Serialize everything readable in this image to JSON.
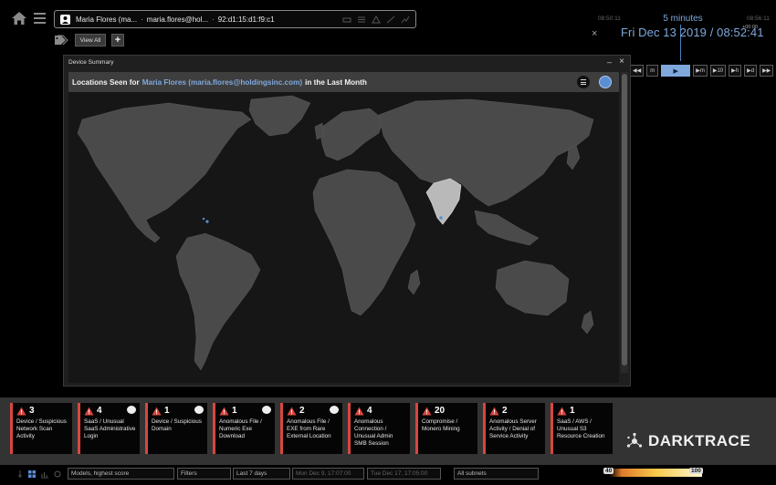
{
  "device": {
    "name": "Maria Flores (ma...",
    "email": "maria.flores@hol...",
    "mac": "92:d1:15:d1:f9:c1",
    "separator": "·"
  },
  "toolbar": {
    "view_all_label": "View All",
    "add_label": "+"
  },
  "time": {
    "scale_left": "08:50:11",
    "scale_right": "08:56:11",
    "window": "5 minutes",
    "offset": "+00:00",
    "current": "Fri Dec 13 2019 / 08:52:41",
    "close_label": "×",
    "playback": [
      "◀◀",
      "d",
      "h",
      "10",
      "m",
      "▶",
      "▶m",
      "▶10",
      "▶h",
      "▶d",
      "▶▶"
    ]
  },
  "summary": {
    "window_title": "Device Summary",
    "minimize_label": "–",
    "close_label": "×",
    "header_prefix": "Locations Seen for",
    "header_highlight": "Maria Flores (maria.flores@holdingsinc.com)",
    "header_suffix": "in the Last Month"
  },
  "alerts": [
    {
      "count": "3",
      "label": "Device / Suspicious Network Scan Activity",
      "bubble": false
    },
    {
      "count": "4",
      "label": "SaaS / Unusual SaaS Administrative Login",
      "bubble": true
    },
    {
      "count": "1",
      "label": "Device / Suspicious Domain",
      "bubble": true
    },
    {
      "count": "1",
      "label": "Anomalous File / Numeric Exe Download",
      "bubble": true
    },
    {
      "count": "2",
      "label": "Anomalous File / EXE from Rare External Location",
      "bubble": true
    },
    {
      "count": "4",
      "label": "Anomalous Connection / Unusual Admin SMB Session",
      "bubble": false
    },
    {
      "count": "20",
      "label": "Compromise / Monero Mining",
      "bubble": false
    },
    {
      "count": "2",
      "label": "Anomalous Server Activity / Denial of Service Activity",
      "bubble": false
    },
    {
      "count": "1",
      "label": "SaaS / AWS / Unusual S3 Resource Creation",
      "bubble": false
    }
  ],
  "brand": {
    "name": "DARKTRACE"
  },
  "bottom": {
    "models": "Models, highest score",
    "filters": "Filters",
    "range": "Last 7 days",
    "date_from": "Mon Dec 9, 17:07:00",
    "date_to": "Tue Dec 17, 17:05:00",
    "subnets": "All subnets",
    "score_min": "40",
    "score_max": "100"
  },
  "colors": {
    "accent": "#7fa8dd",
    "alert_red": "#d9463f",
    "highlight_country": "#b9b9b9",
    "land": "#4a4a4a"
  }
}
